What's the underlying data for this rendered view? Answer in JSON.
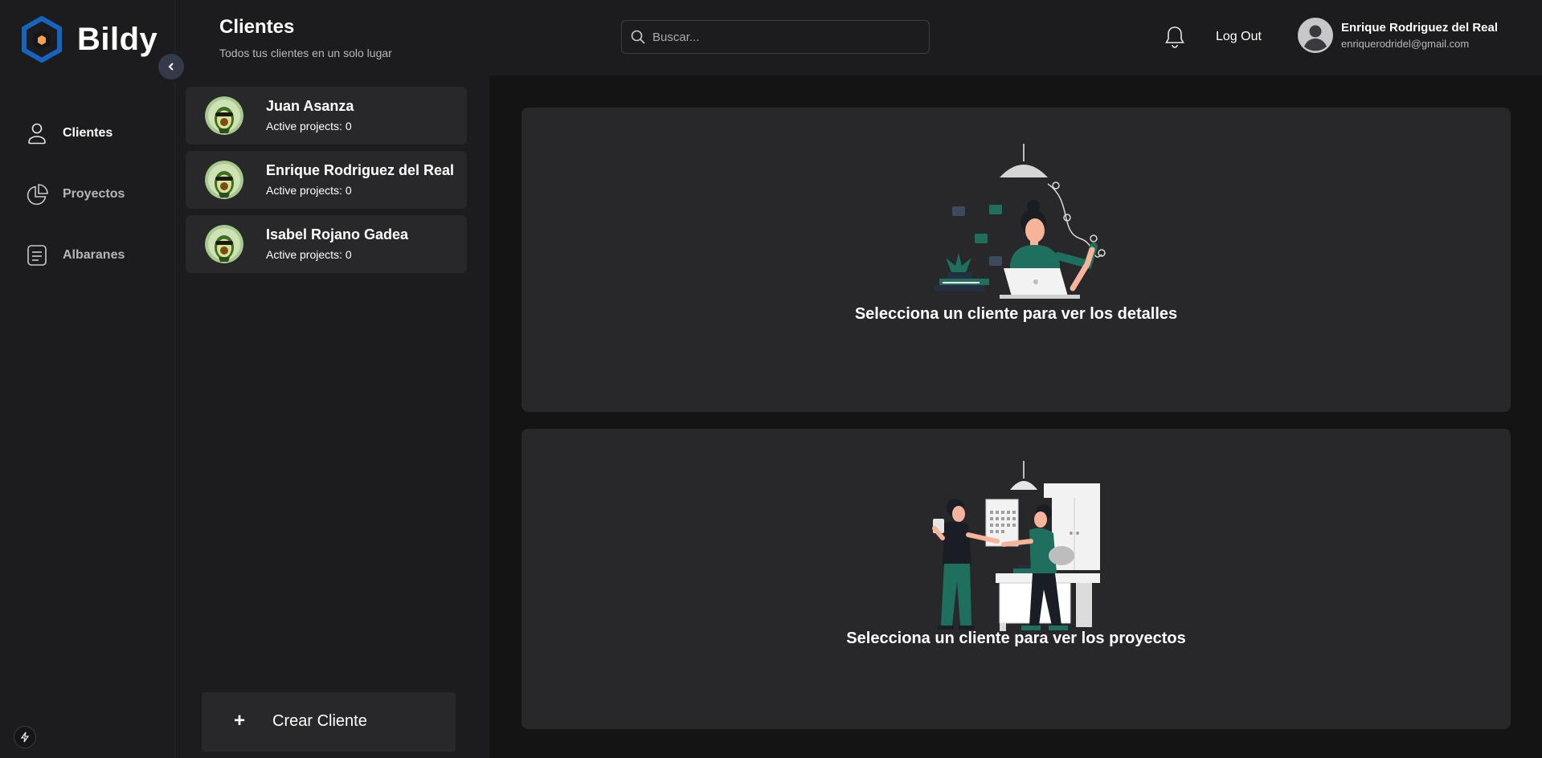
{
  "brand": {
    "name": "Bildy",
    "accent": "#1565c0",
    "hex_inner": "#f5a04a"
  },
  "sidebar": {
    "collapse_icon": "chevron-left-icon",
    "items": [
      {
        "label": "Clientes",
        "icon": "user-icon",
        "active": true
      },
      {
        "label": "Proyectos",
        "icon": "pie-chart-icon",
        "active": false
      },
      {
        "label": "Albaranes",
        "icon": "document-icon",
        "active": false
      }
    ],
    "footer_icon": "bolt-icon"
  },
  "header": {
    "title": "Clientes",
    "subtitle": "Todos tus clientes en un solo lugar",
    "search": {
      "placeholder": "Buscar...",
      "value": ""
    },
    "notifications_icon": "bell-icon",
    "logout_label": "Log Out",
    "user": {
      "name": "Enrique Rodriguez del Real",
      "email": "enriquerodridel@gmail.com"
    }
  },
  "clients": [
    {
      "name": "Juan Asanza",
      "active_label": "Active projects:",
      "active_projects": "0"
    },
    {
      "name": "Enrique Rodriguez del Real",
      "active_label": "Active projects:",
      "active_projects": "0"
    },
    {
      "name": "Isabel Rojano Gadea",
      "active_label": "Active projects:",
      "active_projects": "0"
    }
  ],
  "create_client": {
    "plus": "+",
    "label": "Crear Cliente"
  },
  "main": {
    "details_caption": "Selecciona un cliente para ver los detalles",
    "projects_caption": "Selecciona un cliente para ver los proyectos"
  },
  "colors": {
    "background": "#1c1c1e",
    "panel": "#28282b",
    "main_bg": "#141414",
    "illustration_green": "#1f6f5e",
    "illustration_skin": "#f6b59a"
  }
}
